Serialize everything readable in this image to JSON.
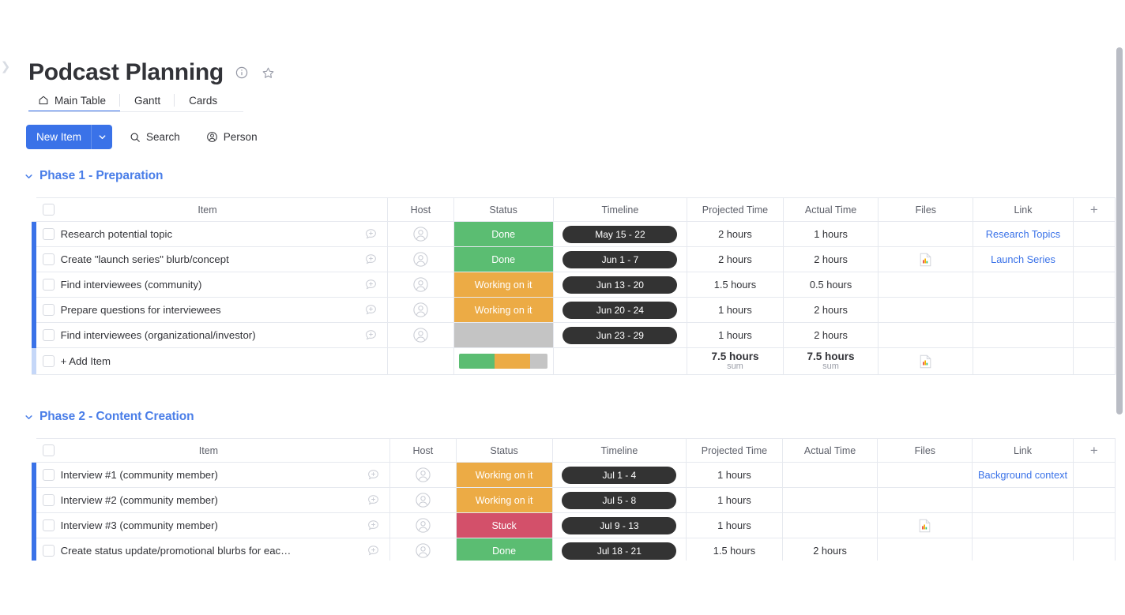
{
  "header": {
    "title": "Podcast Planning",
    "info_icon": "info-icon",
    "favorite_icon": "star-icon"
  },
  "tabs": [
    {
      "label": "Main Table",
      "icon": "home-icon",
      "active": true
    },
    {
      "label": "Gantt",
      "icon": "",
      "active": false
    },
    {
      "label": "Cards",
      "icon": "",
      "active": false
    }
  ],
  "toolbar": {
    "new_item_label": "New Item",
    "new_item_caret": "chevron-down-icon",
    "search_label": "Search",
    "search_icon": "search-icon",
    "person_label": "Person",
    "person_icon": "person-icon"
  },
  "colors": {
    "accent_blue": "#3a72e8",
    "group_title": "#4a7ee8",
    "done": "#5bbd72",
    "working": "#ecab45",
    "stuck": "#d3506a",
    "empty": "#c4c4c4",
    "timeline_pill": "#333333",
    "link": "#3a72e8"
  },
  "columns": [
    "Item",
    "Host",
    "Status",
    "Timeline",
    "Projected Time",
    "Actual Time",
    "Files",
    "Link"
  ],
  "add_column_label": "+",
  "add_item_label": "+ Add Item",
  "groups": [
    {
      "title": "Phase 1 - Preparation",
      "caret": "chevron-down-icon",
      "rows": [
        {
          "item": "Research potential topic",
          "status": "Done",
          "status_color": "#5bbd72",
          "timeline": "May 15 - 22",
          "projected": "2 hours",
          "actual": "1 hours",
          "file": false,
          "link": "Research Topics"
        },
        {
          "item": "Create \"launch series\" blurb/concept",
          "status": "Done",
          "status_color": "#5bbd72",
          "timeline": "Jun 1 - 7",
          "projected": "2 hours",
          "actual": "2 hours",
          "file": true,
          "link": "Launch Series"
        },
        {
          "item": "Find interviewees (community)",
          "status": "Working on it",
          "status_color": "#ecab45",
          "timeline": "Jun 13 - 20",
          "projected": "1.5 hours",
          "actual": "0.5 hours",
          "file": false,
          "link": ""
        },
        {
          "item": "Prepare questions for interviewees",
          "status": "Working on it",
          "status_color": "#ecab45",
          "timeline": "Jun 20 - 24",
          "projected": "1 hours",
          "actual": "2 hours",
          "file": false,
          "link": ""
        },
        {
          "item": "Find interviewees (organizational/investor)",
          "status": "",
          "status_color": "#c4c4c4",
          "timeline": "Jun 23 - 29",
          "projected": "1 hours",
          "actual": "2 hours",
          "file": false,
          "link": ""
        }
      ],
      "summary": {
        "projected_value": "7.5 hours",
        "projected_label": "sum",
        "actual_value": "7.5 hours",
        "actual_label": "sum",
        "file": true,
        "status_distribution": [
          {
            "color": "#5bbd72",
            "weight": 2
          },
          {
            "color": "#ecab45",
            "weight": 2
          },
          {
            "color": "#c4c4c4",
            "weight": 1
          }
        ]
      }
    },
    {
      "title": "Phase 2 - Content Creation",
      "caret": "chevron-down-icon",
      "rows": [
        {
          "item": "Interview #1 (community member)",
          "status": "Working on it",
          "status_color": "#ecab45",
          "timeline": "Jul 1 - 4",
          "projected": "1 hours",
          "actual": "",
          "file": false,
          "link": "Background context"
        },
        {
          "item": "Interview #2 (community member)",
          "status": "Working on it",
          "status_color": "#ecab45",
          "timeline": "Jul 5 - 8",
          "projected": "1 hours",
          "actual": "",
          "file": false,
          "link": ""
        },
        {
          "item": "Interview #3 (community member)",
          "status": "Stuck",
          "status_color": "#d3506a",
          "timeline": "Jul 9 - 13",
          "projected": "1 hours",
          "actual": "",
          "file": true,
          "link": ""
        },
        {
          "item": "Create status update/promotional blurbs for eac…",
          "status": "Done",
          "status_color": "#5bbd72",
          "timeline": "Jul 18 - 21",
          "projected": "1.5 hours",
          "actual": "2 hours",
          "file": false,
          "link": ""
        }
      ],
      "summary": null
    }
  ]
}
